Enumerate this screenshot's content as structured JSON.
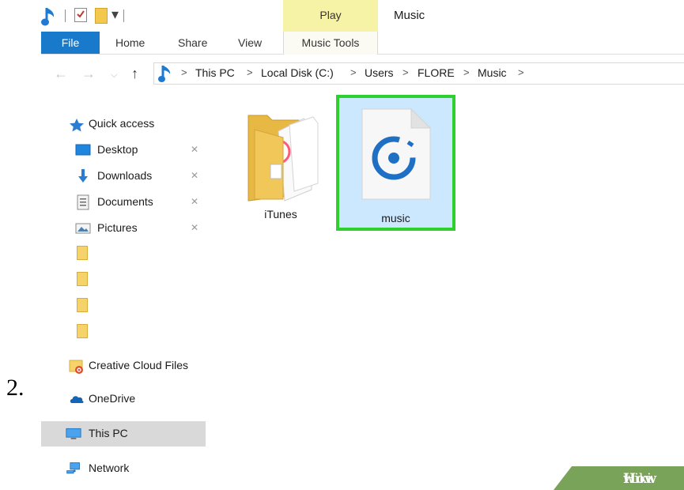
{
  "step_number": "2.",
  "window": {
    "title": "Music",
    "context_tab_group": "Play"
  },
  "ribbon": {
    "tabs": [
      "File",
      "Home",
      "Share",
      "View",
      "Music Tools"
    ],
    "accent_color": "#1979ca"
  },
  "address_bar": {
    "breadcrumbs": [
      "This PC",
      "Local Disk (C:)",
      "Users",
      "FLORE",
      "Music"
    ],
    "separator": ">"
  },
  "nav_pane": {
    "quick_access_label": "Quick access",
    "pinned": [
      {
        "label": "Desktop",
        "icon": "desktop-icon"
      },
      {
        "label": "Downloads",
        "icon": "download-arrow-icon"
      },
      {
        "label": "Documents",
        "icon": "document-icon"
      },
      {
        "label": "Pictures",
        "icon": "pictures-icon"
      }
    ],
    "unlabeled_folders": 4,
    "creative_cloud": "Creative Cloud Files",
    "onedrive": "OneDrive",
    "this_pc": "This PC",
    "network": "Network",
    "selected": "This PC"
  },
  "content": {
    "items": [
      {
        "label": "iTunes",
        "type": "folder",
        "icon": "itunes-folder-icon"
      },
      {
        "label": "music",
        "type": "file",
        "icon": "groove-music-file-icon",
        "selected": true,
        "highlight_color": "#2ed02e"
      }
    ]
  },
  "watermark": {
    "prefix": "wiki",
    "suffix": "How"
  }
}
